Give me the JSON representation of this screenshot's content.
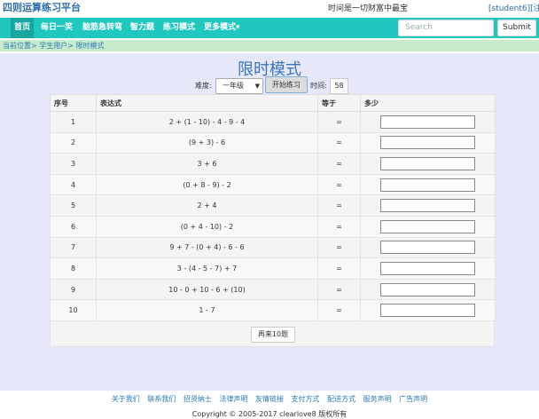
{
  "header": {
    "brand": "四则运算练习平台",
    "slogan": "时间是一切财富中最宝",
    "user": "[student6]",
    "logout": "[注销"
  },
  "nav": {
    "items": [
      {
        "label": "首页",
        "active": true
      },
      {
        "label": "每日一笑",
        "active": false
      },
      {
        "label": "脑筋急转弯",
        "active": false
      },
      {
        "label": "智力题",
        "active": false
      },
      {
        "label": "练习模式",
        "active": false
      },
      {
        "label": "更多模式▾",
        "active": false
      }
    ],
    "search_placeholder": "Search",
    "submit_label": "Submit"
  },
  "breadcrumb": "当前位置> 学生用户> 限时模式",
  "main": {
    "title": "限时模式",
    "difficulty_label": "难度:",
    "difficulty_value": "一年级",
    "start_label": "开始练习",
    "time_label": "时间:",
    "time_value": "58",
    "headers": [
      "序号",
      "表达式",
      "等于",
      "多少"
    ],
    "rows": [
      {
        "n": "1",
        "expr": "2 + (1 - 10) - 4 - 9 - 4",
        "eq": "="
      },
      {
        "n": "2",
        "expr": "(9 + 3) - 6",
        "eq": "="
      },
      {
        "n": "3",
        "expr": "3 + 6",
        "eq": "="
      },
      {
        "n": "4",
        "expr": "(0 + 8 - 9) - 2",
        "eq": "="
      },
      {
        "n": "5",
        "expr": "2 + 4",
        "eq": "="
      },
      {
        "n": "6",
        "expr": "(0 + 4 - 10) - 2",
        "eq": "="
      },
      {
        "n": "7",
        "expr": "9 + 7 - (0 + 4) - 6 - 6",
        "eq": "="
      },
      {
        "n": "8",
        "expr": "3 - (4 - 5 - 7) + 7",
        "eq": "="
      },
      {
        "n": "9",
        "expr": "10 - 0 + 10 - 6 + (10)",
        "eq": "="
      },
      {
        "n": "10",
        "expr": "1 - 7",
        "eq": "="
      }
    ],
    "again_label": "再来10题"
  },
  "footer": {
    "links": [
      "关于我们",
      "联系我们",
      "招贤纳士",
      "法律声明",
      "友情链接",
      "支付方式",
      "配送方式",
      "服务声明",
      "广告声明"
    ],
    "copyright": "Copyright © 2005-2017 clearlove8 版权所有"
  },
  "colors": {
    "navbar": "#1fc7bf",
    "nav_active": "#17a7a0",
    "breadcrumb_bg": "#c8ebcd",
    "main_bg": "#e6e8fa",
    "title": "#3a76b5"
  }
}
